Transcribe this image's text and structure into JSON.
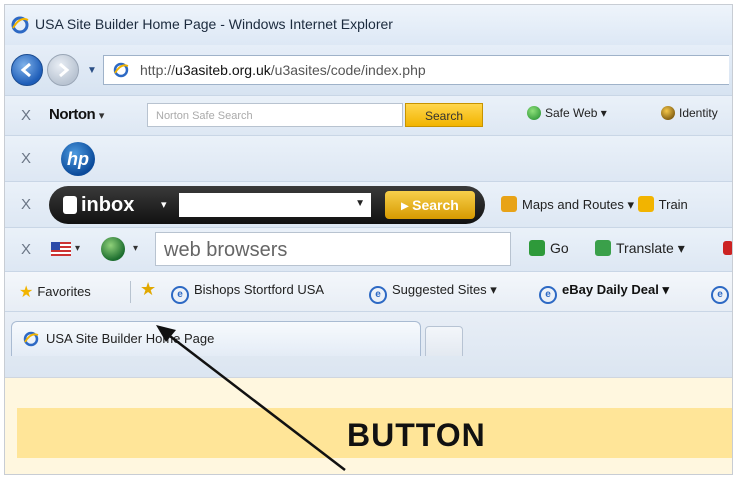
{
  "window": {
    "title": "USA Site Builder Home Page - Windows Internet Explorer"
  },
  "address_bar": {
    "url_prefix": "http://",
    "url_host": "u3asiteb.org.uk",
    "url_path": "/u3asites/code/index.php"
  },
  "norton_toolbar": {
    "close": "X",
    "brand": "Norton",
    "brand_dropdown": "▾",
    "search_placeholder": "Norton Safe Search",
    "search_button": "Search",
    "safe_web": "Safe Web ▾",
    "identity": "Identity"
  },
  "hp_toolbar": {
    "close": "X",
    "logo": "hp"
  },
  "inbox_toolbar": {
    "close": "X",
    "logo": "inbox",
    "dropdown": "▾",
    "search_button": "▸ Search",
    "maps": "Maps and Routes ▾",
    "trains": "Train"
  },
  "search_toolbar": {
    "close": "X",
    "query": "web browsers",
    "go": "Go",
    "translate": "Translate ▾"
  },
  "favorites_bar": {
    "favorites": "Favorites",
    "items": [
      {
        "label": "Bishops Stortford USA",
        "bold": false
      },
      {
        "label": "Suggested Sites ▾",
        "bold": false
      },
      {
        "label": "eBay Daily Deal ▾",
        "bold": true
      }
    ]
  },
  "tabs": [
    {
      "label": "USA Site Builder Home Page"
    }
  ],
  "content": {
    "banner_text": "BUTTON"
  },
  "colors": {
    "accent_blue": "#2d69c4",
    "search_yellow": "#f2b400",
    "banner_yellow": "#ffe598"
  }
}
